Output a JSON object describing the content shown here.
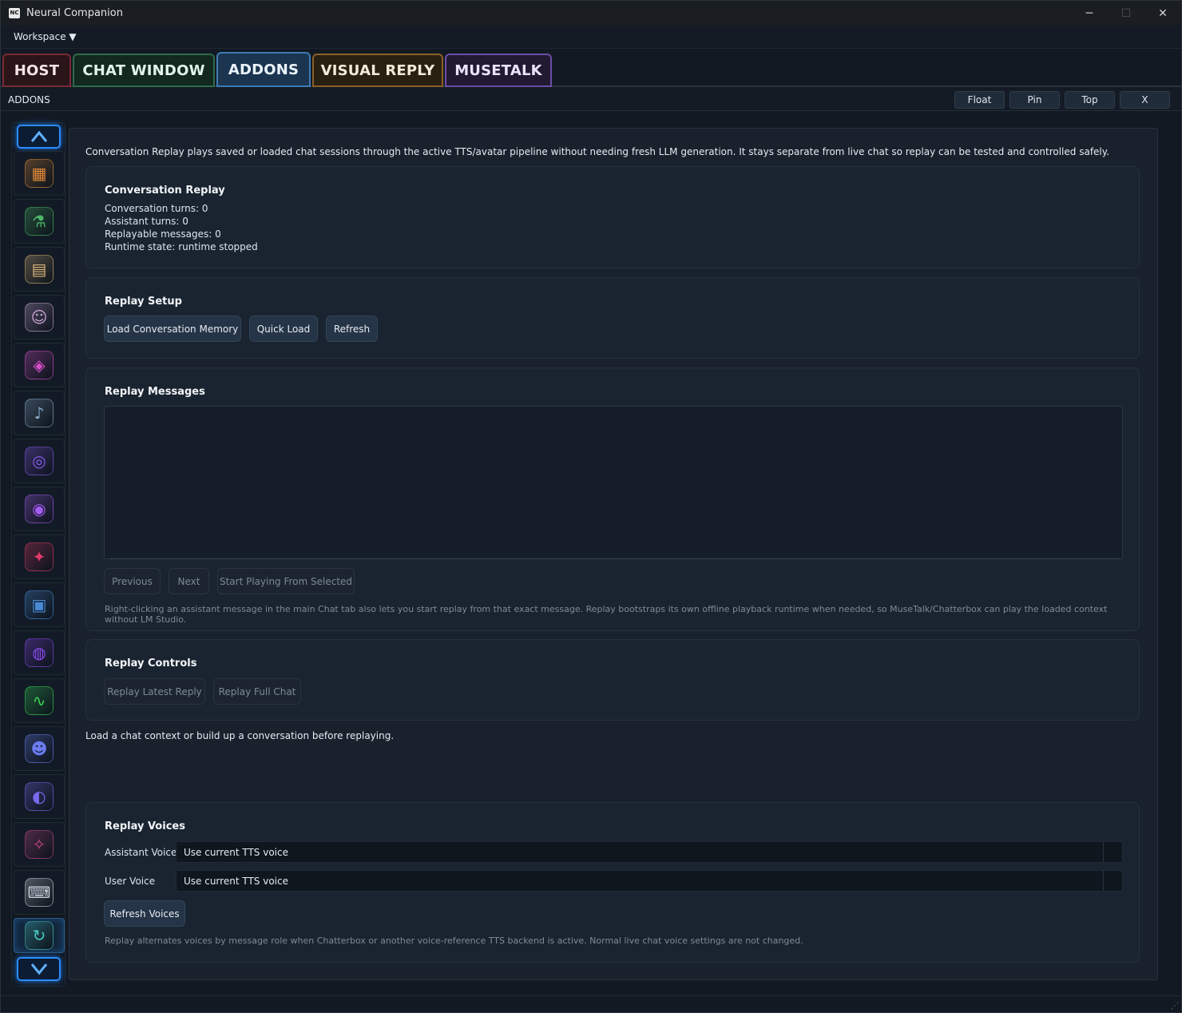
{
  "window": {
    "logo_text": "NC",
    "title": "Neural Companion",
    "minimize": "─",
    "maximize": "☐",
    "close": "✕"
  },
  "menu": {
    "workspace": "Workspace ▼"
  },
  "tabs": [
    {
      "label": "HOST"
    },
    {
      "label": "CHAT WINDOW"
    },
    {
      "label": "ADDONS"
    },
    {
      "label": "VISUAL REPLY"
    },
    {
      "label": "MUSETALK"
    }
  ],
  "panel": {
    "title": "ADDONS",
    "buttons": {
      "float": "Float",
      "pin": "Pin",
      "top": "Top",
      "close": "X"
    }
  },
  "sidebar": {
    "items": [
      {
        "icon": "dashboard-icon",
        "glyph": "▦",
        "color": "#e08a3a"
      },
      {
        "icon": "flask-icon",
        "glyph": "⚗",
        "color": "#4fb86a"
      },
      {
        "icon": "book-icon",
        "glyph": "▤",
        "color": "#d6b27a"
      },
      {
        "icon": "mask-icon",
        "glyph": "☺",
        "color": "#c9a4d6"
      },
      {
        "icon": "avatar-book-icon",
        "glyph": "◈",
        "color": "#d64fc9"
      },
      {
        "icon": "microphone-icon",
        "glyph": "♪",
        "color": "#8aa8c8"
      },
      {
        "icon": "target-icon",
        "glyph": "◎",
        "color": "#8a5cf0"
      },
      {
        "icon": "orb-icon",
        "glyph": "◉",
        "color": "#a35cf0"
      },
      {
        "icon": "crest-icon",
        "glyph": "✦",
        "color": "#e03a6a"
      },
      {
        "icon": "image-icon",
        "glyph": "▣",
        "color": "#4a8ad6"
      },
      {
        "icon": "globe-icon",
        "glyph": "◍",
        "color": "#8a4af0"
      },
      {
        "icon": "waveform-icon",
        "glyph": "∿",
        "color": "#3ad65a"
      },
      {
        "icon": "chat-bubbles-icon",
        "glyph": "☻",
        "color": "#6a7cf0"
      },
      {
        "icon": "discord-icon",
        "glyph": "◐",
        "color": "#7a6af0"
      },
      {
        "icon": "network-icon",
        "glyph": "✧",
        "color": "#c94a8a"
      },
      {
        "icon": "keyboard-icon",
        "glyph": "⌨",
        "color": "#c8d0dc"
      },
      {
        "icon": "replay-icon",
        "glyph": "↻",
        "color": "#4ac8c0"
      }
    ]
  },
  "main": {
    "intro": "Conversation Replay plays saved or loaded chat sessions through the active TTS/avatar pipeline without needing fresh LLM generation. It stays separate from live chat so replay can be tested and controlled safely.",
    "replay": {
      "title": "Conversation Replay",
      "lines": [
        "Conversation turns: 0",
        "Assistant turns: 0",
        "Replayable messages: 0",
        "Runtime state: runtime stopped"
      ]
    },
    "setup": {
      "title": "Replay Setup",
      "load": "Load Conversation Memory",
      "quick": "Quick Load",
      "refresh": "Refresh"
    },
    "messages": {
      "title": "Replay Messages",
      "previous": "Previous",
      "next": "Next",
      "start": "Start Playing From Selected",
      "note": "Right-clicking an assistant message in the main Chat tab also lets you start replay from that exact message. Replay bootstraps its own offline playback runtime when needed, so MuseTalk/Chatterbox can play the loaded context without LM Studio."
    },
    "controls": {
      "title": "Replay Controls",
      "latest": "Replay Latest Reply",
      "full": "Replay Full Chat"
    },
    "status": "Load a chat context or build up a conversation before replaying.",
    "voices": {
      "title": "Replay Voices",
      "assistant_label": "Assistant Voice",
      "assistant_value": "Use current TTS voice",
      "user_label": "User Voice",
      "user_value": "Use current TTS voice",
      "refresh": "Refresh Voices",
      "note": "Replay alternates voices by message role when Chatterbox or another voice-reference TTS backend is active. Normal live chat voice settings are not changed."
    }
  }
}
